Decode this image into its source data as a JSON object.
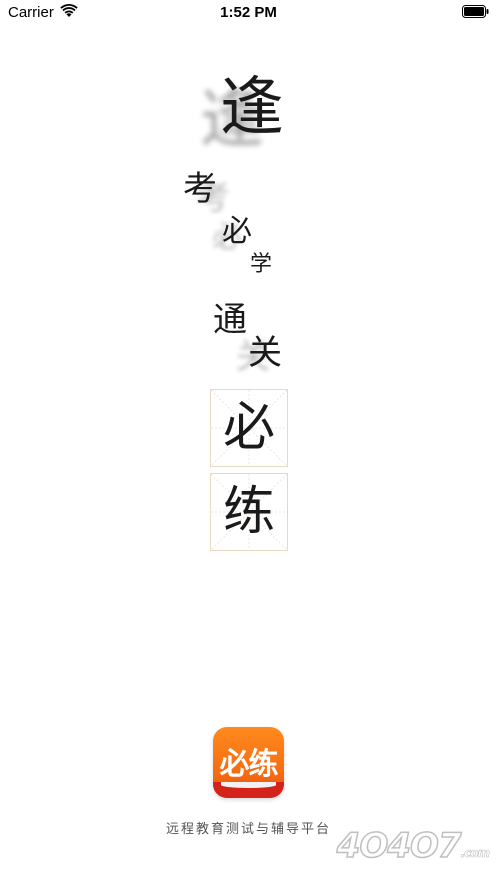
{
  "status_bar": {
    "carrier": "Carrier",
    "time": "1:52 PM"
  },
  "poem": {
    "feng": "逢",
    "kao": "考",
    "bi": "必",
    "xue": "学",
    "tong": "通",
    "guan": "关"
  },
  "grid_chars": {
    "first": "必",
    "second": "练"
  },
  "logo": {
    "text": "必练",
    "colors": {
      "top": "#ff8a1e",
      "bottom": "#e0451b",
      "book": "#d4231a"
    }
  },
  "tagline": "远程教育测试与辅导平台",
  "watermark": {
    "main": "4O4O7",
    "suffix": ".com"
  }
}
